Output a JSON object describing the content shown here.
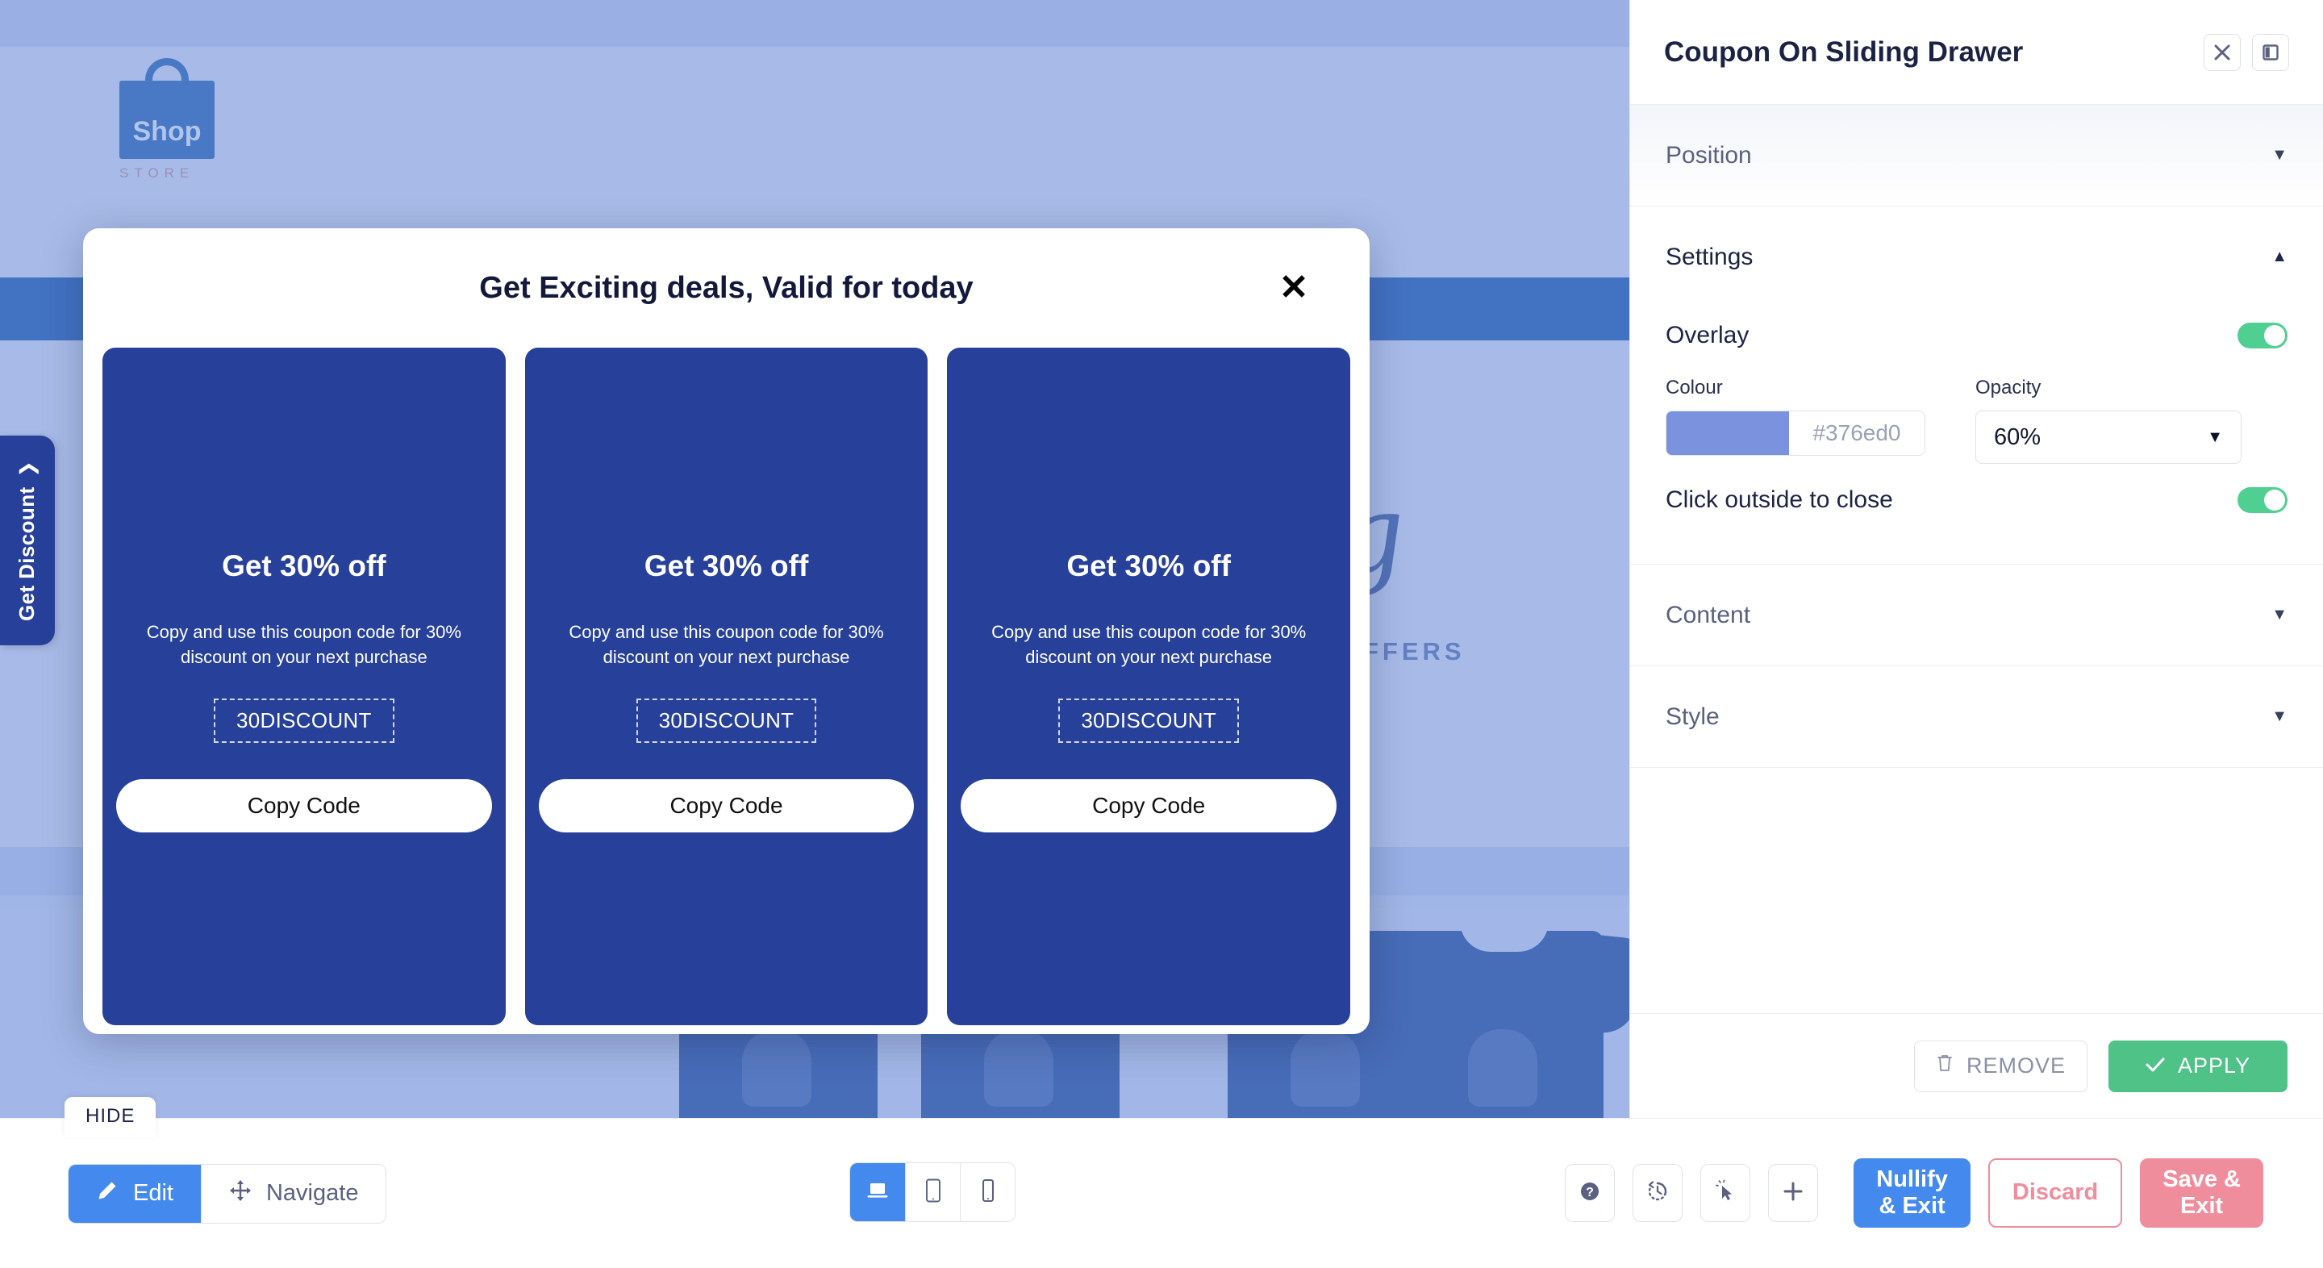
{
  "canvas": {
    "site": {
      "logo_word": "Shop",
      "logo_sub": "STORE",
      "script_text": "ing",
      "offers_text": "FFERS"
    },
    "discount_tab": {
      "label": "Get Discount",
      "chevron": "❯"
    },
    "hide_chip": {
      "label": "HIDE"
    },
    "modal": {
      "title": "Get Exciting deals, Valid for today",
      "close_icon": "✕",
      "coupons": [
        {
          "title": "Get 30% off",
          "description": "Copy and use this coupon code for 30% discount on your next purchase",
          "code": "30DISCOUNT",
          "button_label": "Copy Code"
        },
        {
          "title": "Get 30% off",
          "description": "Copy and use this coupon code for 30% discount on your next purchase",
          "code": "30DISCOUNT",
          "button_label": "Copy Code"
        },
        {
          "title": "Get 30% off",
          "description": "Copy and use this coupon code for 30% discount on your next purchase",
          "code": "30DISCOUNT",
          "button_label": "Copy Code"
        }
      ]
    }
  },
  "panel": {
    "title": "Coupon On Sliding Drawer",
    "sections": {
      "position": {
        "label": "Position",
        "caret": "▼"
      },
      "settings": {
        "label": "Settings",
        "caret": "▲"
      },
      "content": {
        "label": "Content",
        "caret": "▼"
      },
      "style": {
        "label": "Style",
        "caret": "▼"
      }
    },
    "settings": {
      "overlay": {
        "label": "Overlay",
        "enabled": "on"
      },
      "colour": {
        "label": "Colour",
        "value": "#376ed0",
        "swatch": "#7b93df"
      },
      "opacity": {
        "label": "Opacity",
        "value": "60%",
        "arrow": "▼"
      },
      "click_outside": {
        "label": "Click outside to close",
        "enabled": "on"
      }
    },
    "footer": {
      "remove_label": "REMOVE",
      "apply_label": "APPLY"
    }
  },
  "toolbar": {
    "mode": {
      "edit_label": "Edit",
      "navigate_label": "Navigate"
    },
    "devices": {
      "desktop": "desktop-view",
      "tablet": "tablet-view",
      "mobile": "mobile-view"
    },
    "tools": {
      "help": "help-icon",
      "history": "history-icon",
      "pointer": "pointer-icon",
      "add": "plus-icon"
    },
    "actions": {
      "nullify_label": "Nullify\n& Exit",
      "discard_label": "Discard",
      "save_label": "Save &\nExit"
    }
  },
  "colors": {
    "accent_blue": "#448aee",
    "coupon_blue": "#27409a",
    "green": "#4fc288",
    "pink": "#ef8d9c",
    "overlay": "#376ed0"
  }
}
